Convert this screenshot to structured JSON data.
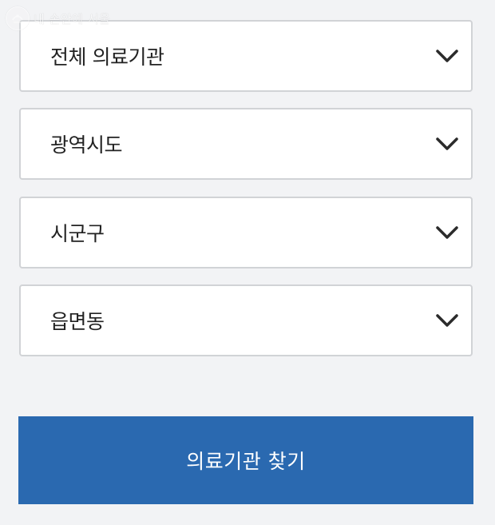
{
  "watermark": {
    "text": "내 손안에 서울"
  },
  "filters": {
    "institution_type": {
      "selected": "전체 의료기관"
    },
    "province": {
      "selected": "광역시도"
    },
    "district": {
      "selected": "시군구"
    },
    "town": {
      "selected": "읍면동"
    }
  },
  "actions": {
    "search_label": "의료기관 찾기"
  },
  "icons": {
    "dropdown": "chevron-down-icon"
  },
  "colors": {
    "background": "#f2f3f5",
    "primary_button": "#2a69b0",
    "select_border": "#d1d3d6",
    "text": "#222222"
  }
}
